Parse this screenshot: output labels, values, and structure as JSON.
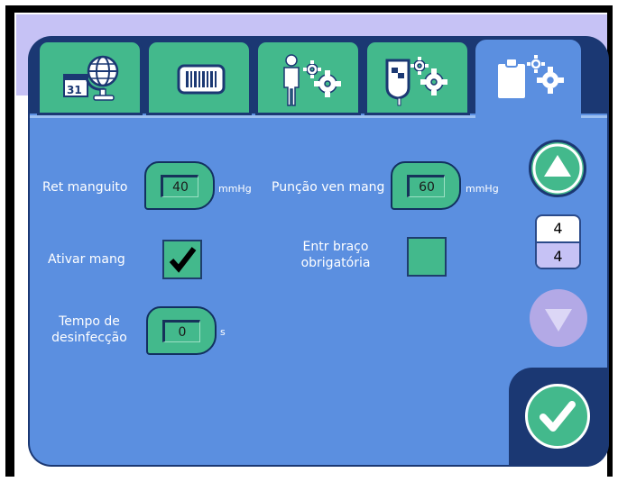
{
  "tabs": [
    {
      "name": "calendar-globe",
      "icon": "calendar-globe-icon"
    },
    {
      "name": "barcode",
      "icon": "barcode-icon"
    },
    {
      "name": "patient-settings",
      "icon": "person-gears-icon"
    },
    {
      "name": "device-settings",
      "icon": "device-gears-icon"
    },
    {
      "name": "clipboard-settings",
      "icon": "clipboard-gears-icon",
      "active": true
    }
  ],
  "settings": {
    "cuff_retention": {
      "label": "Ret manguito",
      "value": "40",
      "unit": "mmHg"
    },
    "venous_puncture": {
      "label": "Punção ven mang",
      "value": "60",
      "unit": "mmHg"
    },
    "activate_cuff": {
      "label": "Ativar mang",
      "checked": true
    },
    "arm_entry": {
      "label_line1": "Entr braço",
      "label_line2": "obrigatória",
      "checked": false
    },
    "disinfection_time": {
      "label_line1": "Tempo de",
      "label_line2": "desinfecção",
      "value": "0",
      "unit": "s"
    }
  },
  "pager": {
    "current": "4",
    "total": "4"
  },
  "colors": {
    "panel": "#5b8fe0",
    "dark": "#1b3873",
    "green": "#43b98c",
    "lavender": "#c6c2f5"
  }
}
